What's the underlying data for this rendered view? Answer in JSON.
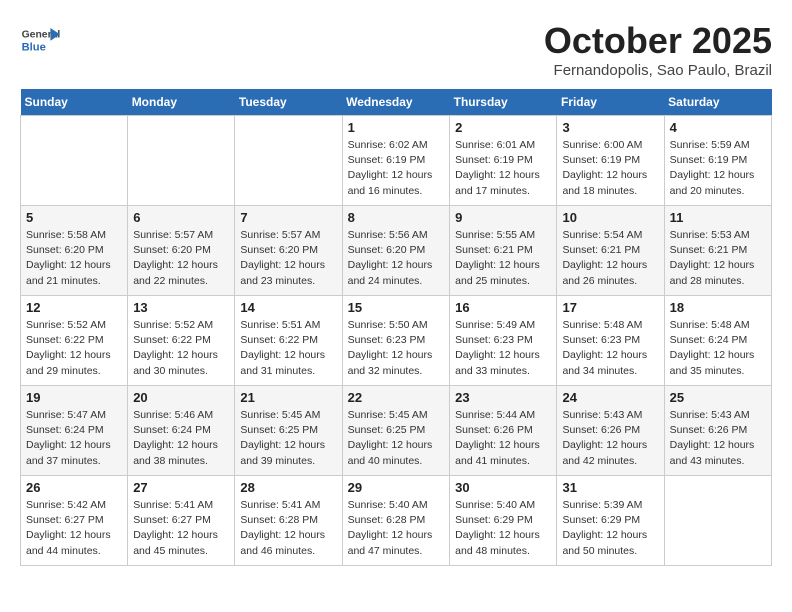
{
  "header": {
    "logo_general": "General",
    "logo_blue": "Blue",
    "month_title": "October 2025",
    "location": "Fernandopolis, Sao Paulo, Brazil"
  },
  "weekdays": [
    "Sunday",
    "Monday",
    "Tuesday",
    "Wednesday",
    "Thursday",
    "Friday",
    "Saturday"
  ],
  "weeks": [
    [
      {
        "day": "",
        "content": ""
      },
      {
        "day": "",
        "content": ""
      },
      {
        "day": "",
        "content": ""
      },
      {
        "day": "1",
        "content": "Sunrise: 6:02 AM\nSunset: 6:19 PM\nDaylight: 12 hours\nand 16 minutes."
      },
      {
        "day": "2",
        "content": "Sunrise: 6:01 AM\nSunset: 6:19 PM\nDaylight: 12 hours\nand 17 minutes."
      },
      {
        "day": "3",
        "content": "Sunrise: 6:00 AM\nSunset: 6:19 PM\nDaylight: 12 hours\nand 18 minutes."
      },
      {
        "day": "4",
        "content": "Sunrise: 5:59 AM\nSunset: 6:19 PM\nDaylight: 12 hours\nand 20 minutes."
      }
    ],
    [
      {
        "day": "5",
        "content": "Sunrise: 5:58 AM\nSunset: 6:20 PM\nDaylight: 12 hours\nand 21 minutes."
      },
      {
        "day": "6",
        "content": "Sunrise: 5:57 AM\nSunset: 6:20 PM\nDaylight: 12 hours\nand 22 minutes."
      },
      {
        "day": "7",
        "content": "Sunrise: 5:57 AM\nSunset: 6:20 PM\nDaylight: 12 hours\nand 23 minutes."
      },
      {
        "day": "8",
        "content": "Sunrise: 5:56 AM\nSunset: 6:20 PM\nDaylight: 12 hours\nand 24 minutes."
      },
      {
        "day": "9",
        "content": "Sunrise: 5:55 AM\nSunset: 6:21 PM\nDaylight: 12 hours\nand 25 minutes."
      },
      {
        "day": "10",
        "content": "Sunrise: 5:54 AM\nSunset: 6:21 PM\nDaylight: 12 hours\nand 26 minutes."
      },
      {
        "day": "11",
        "content": "Sunrise: 5:53 AM\nSunset: 6:21 PM\nDaylight: 12 hours\nand 28 minutes."
      }
    ],
    [
      {
        "day": "12",
        "content": "Sunrise: 5:52 AM\nSunset: 6:22 PM\nDaylight: 12 hours\nand 29 minutes."
      },
      {
        "day": "13",
        "content": "Sunrise: 5:52 AM\nSunset: 6:22 PM\nDaylight: 12 hours\nand 30 minutes."
      },
      {
        "day": "14",
        "content": "Sunrise: 5:51 AM\nSunset: 6:22 PM\nDaylight: 12 hours\nand 31 minutes."
      },
      {
        "day": "15",
        "content": "Sunrise: 5:50 AM\nSunset: 6:23 PM\nDaylight: 12 hours\nand 32 minutes."
      },
      {
        "day": "16",
        "content": "Sunrise: 5:49 AM\nSunset: 6:23 PM\nDaylight: 12 hours\nand 33 minutes."
      },
      {
        "day": "17",
        "content": "Sunrise: 5:48 AM\nSunset: 6:23 PM\nDaylight: 12 hours\nand 34 minutes."
      },
      {
        "day": "18",
        "content": "Sunrise: 5:48 AM\nSunset: 6:24 PM\nDaylight: 12 hours\nand 35 minutes."
      }
    ],
    [
      {
        "day": "19",
        "content": "Sunrise: 5:47 AM\nSunset: 6:24 PM\nDaylight: 12 hours\nand 37 minutes."
      },
      {
        "day": "20",
        "content": "Sunrise: 5:46 AM\nSunset: 6:24 PM\nDaylight: 12 hours\nand 38 minutes."
      },
      {
        "day": "21",
        "content": "Sunrise: 5:45 AM\nSunset: 6:25 PM\nDaylight: 12 hours\nand 39 minutes."
      },
      {
        "day": "22",
        "content": "Sunrise: 5:45 AM\nSunset: 6:25 PM\nDaylight: 12 hours\nand 40 minutes."
      },
      {
        "day": "23",
        "content": "Sunrise: 5:44 AM\nSunset: 6:26 PM\nDaylight: 12 hours\nand 41 minutes."
      },
      {
        "day": "24",
        "content": "Sunrise: 5:43 AM\nSunset: 6:26 PM\nDaylight: 12 hours\nand 42 minutes."
      },
      {
        "day": "25",
        "content": "Sunrise: 5:43 AM\nSunset: 6:26 PM\nDaylight: 12 hours\nand 43 minutes."
      }
    ],
    [
      {
        "day": "26",
        "content": "Sunrise: 5:42 AM\nSunset: 6:27 PM\nDaylight: 12 hours\nand 44 minutes."
      },
      {
        "day": "27",
        "content": "Sunrise: 5:41 AM\nSunset: 6:27 PM\nDaylight: 12 hours\nand 45 minutes."
      },
      {
        "day": "28",
        "content": "Sunrise: 5:41 AM\nSunset: 6:28 PM\nDaylight: 12 hours\nand 46 minutes."
      },
      {
        "day": "29",
        "content": "Sunrise: 5:40 AM\nSunset: 6:28 PM\nDaylight: 12 hours\nand 47 minutes."
      },
      {
        "day": "30",
        "content": "Sunrise: 5:40 AM\nSunset: 6:29 PM\nDaylight: 12 hours\nand 48 minutes."
      },
      {
        "day": "31",
        "content": "Sunrise: 5:39 AM\nSunset: 6:29 PM\nDaylight: 12 hours\nand 50 minutes."
      },
      {
        "day": "",
        "content": ""
      }
    ]
  ]
}
